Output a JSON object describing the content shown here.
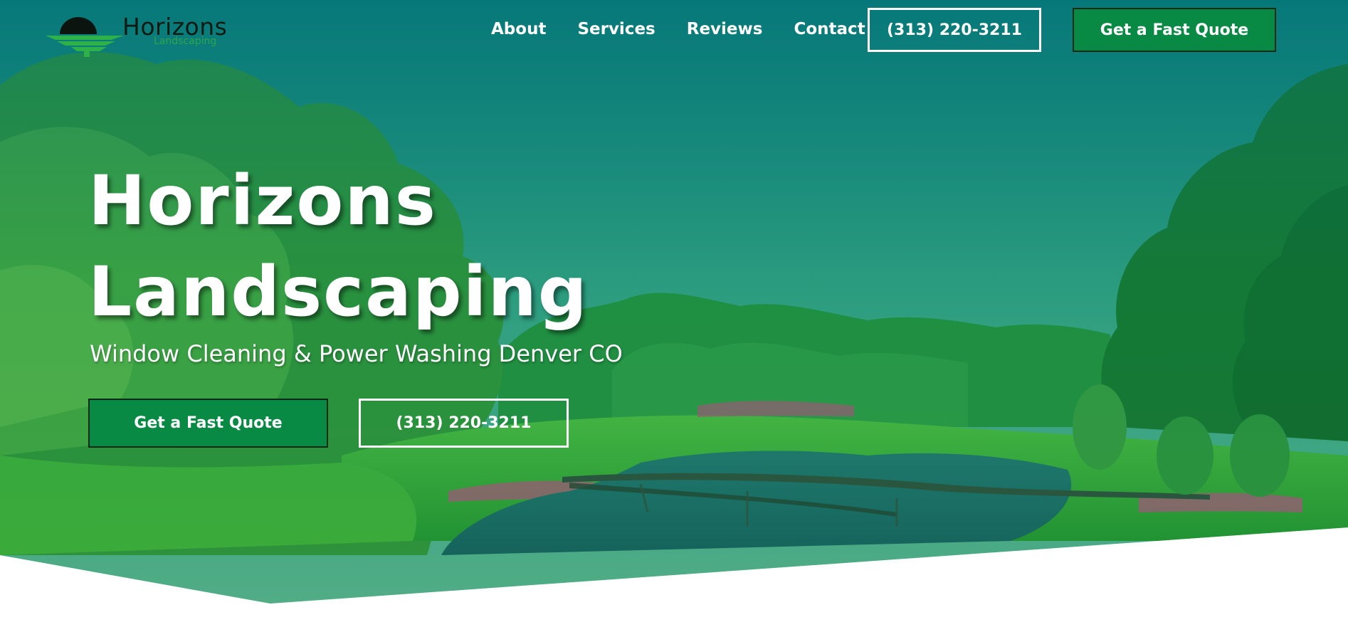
{
  "brand": {
    "name": "Horizons",
    "tagline": "Landscaping"
  },
  "nav": {
    "items": [
      {
        "label": "About"
      },
      {
        "label": "Services"
      },
      {
        "label": "Reviews"
      },
      {
        "label": "Contact"
      }
    ]
  },
  "header": {
    "phone_label": "(313) 220-3211",
    "quote_label": "Get a Fast Quote"
  },
  "hero": {
    "title_line1": "Horizons",
    "title_line2": "Landscaping",
    "subtitle": "Window Cleaning & Power Washing Denver CO",
    "primary_cta": "Get a Fast Quote",
    "secondary_cta": "(313) 220-3211"
  },
  "theme": {
    "accent": "#098a44",
    "overlay": "#0a7d78",
    "text": "#ffffff",
    "logo_text": "#0d1a12",
    "logo_accent": "#2fa64a"
  },
  "icons": {
    "logo": "horizons-sun-trees-logo"
  }
}
